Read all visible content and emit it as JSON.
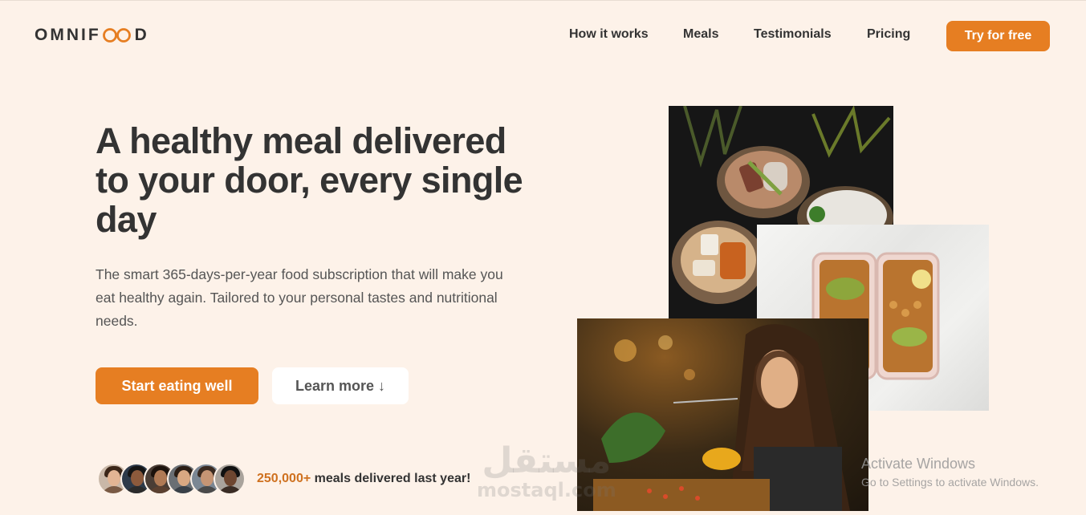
{
  "header": {
    "logo_text_left": "OMNIF",
    "logo_text_right": "D",
    "nav": [
      "How it works",
      "Meals",
      "Testimonials",
      "Pricing"
    ],
    "cta_label": "Try for free"
  },
  "hero": {
    "title": "A healthy meal delivered to your door, every single day",
    "description": "The smart 365-days-per-year food subscription that will make you eat healthy again. Tailored to your personal tastes and nutritional needs.",
    "primary_button": "Start eating well",
    "secondary_button": "Learn more ↓"
  },
  "delivered": {
    "count": "250,000+",
    "text": " meals delivered last year!",
    "avatars": 6
  },
  "watermark": {
    "arabic": "مستقل",
    "latin": "mostaql.com"
  },
  "os_notice": {
    "title": "Activate Windows",
    "subtitle": "Go to Settings to activate Windows."
  },
  "colors": {
    "background": "#fdf2e9",
    "accent": "#e67e22",
    "accent_dark": "#cf711f",
    "text": "#333333"
  }
}
